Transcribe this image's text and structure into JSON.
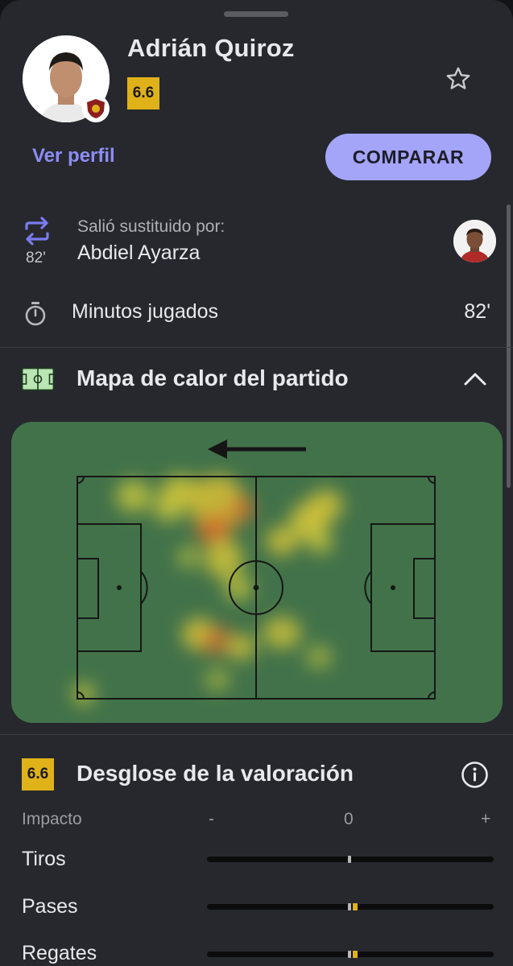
{
  "player": {
    "name": "Adrián Quiroz",
    "rating": "6.6",
    "view_profile_label": "Ver perfil",
    "compare_label": "COMPARAR"
  },
  "substitution": {
    "label": "Salió sustituido por:",
    "replacement_name": "Abdiel Ayarza",
    "minute": "82'"
  },
  "minutes_played": {
    "label": "Minutos jugados",
    "value": "82'"
  },
  "heatmap": {
    "title": "Mapa de calor del partido"
  },
  "rating_breakdown": {
    "rating": "6.6",
    "title": "Desglose de la valoración",
    "impact_label": "Impacto",
    "scale_minus": "-",
    "scale_zero": "0",
    "scale_plus": "+",
    "rows": [
      {
        "label": "Tiros",
        "impact": 0
      },
      {
        "label": "Pases",
        "impact": 0.02
      },
      {
        "label": "Regates",
        "impact": 0.02
      }
    ]
  },
  "colors": {
    "accent": "#a4a4f8",
    "link": "#8d8df5",
    "rating": "#e0b21a",
    "pitch": "#42724a",
    "background": "#26282d"
  }
}
